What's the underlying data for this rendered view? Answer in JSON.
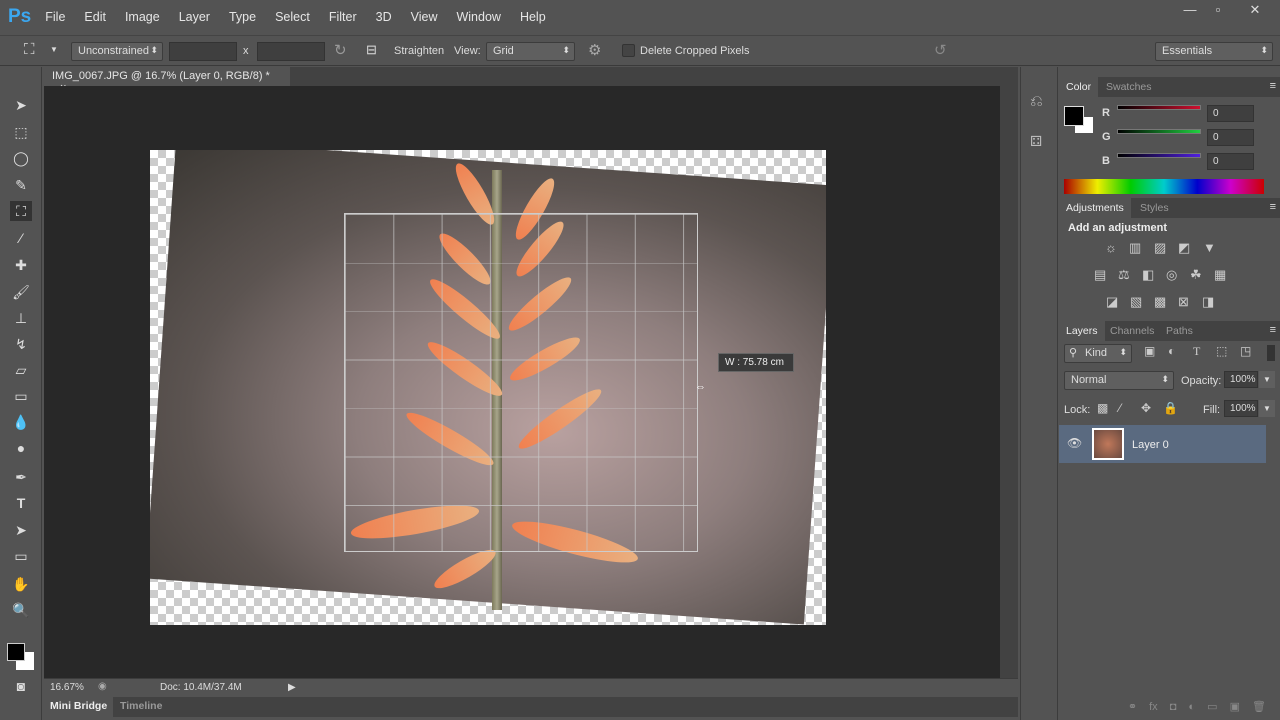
{
  "app": {
    "logo": "Ps",
    "menus": [
      "File",
      "Edit",
      "Image",
      "Layer",
      "Type",
      "Select",
      "Filter",
      "3D",
      "View",
      "Window",
      "Help"
    ],
    "window_controls": [
      "minimize",
      "maximize",
      "close"
    ]
  },
  "options": {
    "ratio": "Unconstrained",
    "x_sep": "x",
    "straighten": "Straighten",
    "view_label": "View:",
    "view_value": "Grid",
    "delete_cropped": "Delete Cropped Pixels",
    "workspace": "Essentials"
  },
  "document": {
    "tab_title": "IMG_0067.JPG @ 16.7% (Layer 0, RGB/8) *",
    "close": "×",
    "tooltip": "W :  75.78 cm"
  },
  "status": {
    "zoom": "16.67%",
    "doc": "Doc: 10.4M/37.4M"
  },
  "bottom_tabs": [
    "Mini Bridge",
    "Timeline"
  ],
  "color_panel": {
    "tabs": [
      "Color",
      "Swatches"
    ],
    "channels": [
      {
        "label": "R",
        "value": "0",
        "color": "#d01030"
      },
      {
        "label": "G",
        "value": "0",
        "color": "#20d040"
      },
      {
        "label": "B",
        "value": "0",
        "color": "#5020e0"
      }
    ]
  },
  "adjustments": {
    "tabs": [
      "Adjustments",
      "Styles"
    ],
    "heading": "Add an adjustment"
  },
  "layers": {
    "tabs": [
      "Layers",
      "Channels",
      "Paths"
    ],
    "filter": "Kind",
    "blend": "Normal",
    "opacity_label": "Opacity:",
    "opacity": "100%",
    "lock_label": "Lock:",
    "fill_label": "Fill:",
    "fill": "100%",
    "items": [
      {
        "name": "Layer 0"
      }
    ]
  }
}
